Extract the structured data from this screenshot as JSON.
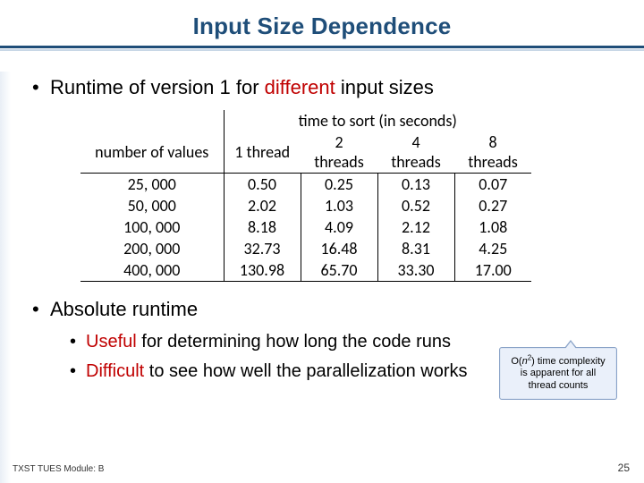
{
  "title": "Input Size Dependence",
  "bullets": {
    "b1_pre": "Runtime of version 1 for ",
    "b1_emph": "different",
    "b1_post": " input sizes",
    "b2": "Absolute runtime",
    "b3_emph": "Useful",
    "b3_post": " for determining how long the code runs",
    "b4_emph": "Difficult",
    "b4_post": " to see how well the parallelization works"
  },
  "table": {
    "row_header_label": "number of values",
    "group_header_label": "time to sort (in seconds)",
    "col_headers": [
      "1 thread",
      "2 threads",
      "4 threads",
      "8 threads"
    ],
    "rows": [
      {
        "n": "25, 000",
        "v": [
          "0.50",
          "0.25",
          "0.13",
          "0.07"
        ]
      },
      {
        "n": "50, 000",
        "v": [
          "2.02",
          "1.03",
          "0.52",
          "0.27"
        ]
      },
      {
        "n": "100, 000",
        "v": [
          "8.18",
          "4.09",
          "2.12",
          "1.08"
        ]
      },
      {
        "n": "200, 000",
        "v": [
          "32.73",
          "16.48",
          "8.31",
          "4.25"
        ]
      },
      {
        "n": "400, 000",
        "v": [
          "130.98",
          "65.70",
          "33.30",
          "17.00"
        ]
      }
    ]
  },
  "callout": {
    "line1_pre": "O(",
    "line1_n": "n",
    "line1_sup": "2",
    "line1_post": ") time complexity",
    "line2": "is apparent for all",
    "line3": "thread counts"
  },
  "footer": {
    "left": "TXST TUES Module: B",
    "pagenum": "25"
  }
}
